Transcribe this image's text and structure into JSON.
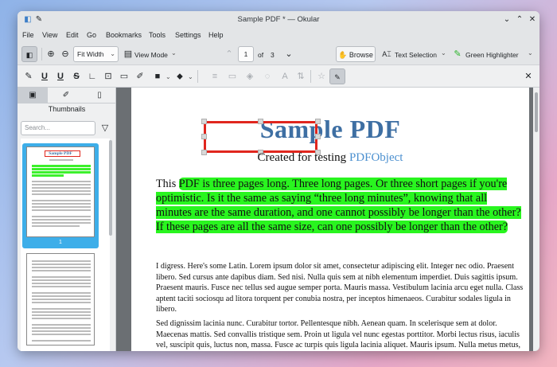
{
  "window": {
    "title": "Sample PDF * — Okular"
  },
  "menu": [
    "File",
    "View",
    "Edit",
    "Go",
    "Bookmarks",
    "Tools",
    "Settings",
    "Help"
  ],
  "toolbar": {
    "zoom_mode": "Fit Width",
    "view_mode": "View Mode",
    "page_current": "1",
    "page_of": "of",
    "page_total": "3",
    "browse": "Browse",
    "text_selection": "Text Selection",
    "highlighter": "Green Highlighter"
  },
  "sidebar": {
    "heading": "Thumbnails",
    "search_placeholder": "Search...",
    "thumb_mini_title": "Sample PDF",
    "thumb_page_number": "1"
  },
  "document": {
    "title": "Sample PDF",
    "subtitle_prefix": "Created for testing ",
    "subtitle_link": "PDFObject",
    "para1_lead": "This ",
    "para1_highlight": "PDF is three pages long. Three long pages. Or three short pages if you're optimistic. Is it the same as saying “three long minutes”, knowing that all minutes are the same duration, and one cannot possibly be longer than the other? If these pages are all the same size, can one possibly be longer than the other?",
    "para2": "I digress. Here's some Latin. Lorem ipsum dolor sit amet, consectetur adipiscing elit. Integer nec odio. Praesent libero. Sed cursus ante dapibus diam. Sed nisi. Nulla quis sem at nibh elementum imperdiet. Duis sagittis ipsum. Praesent mauris. Fusce nec tellus sed augue semper porta. Mauris massa. Vestibulum lacinia arcu eget nulla. Class aptent taciti sociosqu ad litora torquent per conubia nostra, per inceptos himenaeos. Curabitur sodales ligula in libero.",
    "para3": "Sed dignissim lacinia nunc. Curabitur tortor. Pellentesque nibh. Aenean quam. In scelerisque sem at dolor. Maecenas mattis. Sed convallis tristique sem. Proin ut ligula vel nunc egestas porttitor. Morbi lectus risus, iaculis vel, suscipit quis, luctus non, massa. Fusce ac turpis quis ligula lacinia aliquet. Mauris ipsum. Nulla metus metus, ullamcorper vel, tincidunt sed, euismod in, nibh."
  },
  "colors": {
    "highlight": "#29f51f",
    "annotation_box": "#e0261e",
    "title_blue": "#3e6fa3",
    "selection_blue": "#3daee9"
  }
}
